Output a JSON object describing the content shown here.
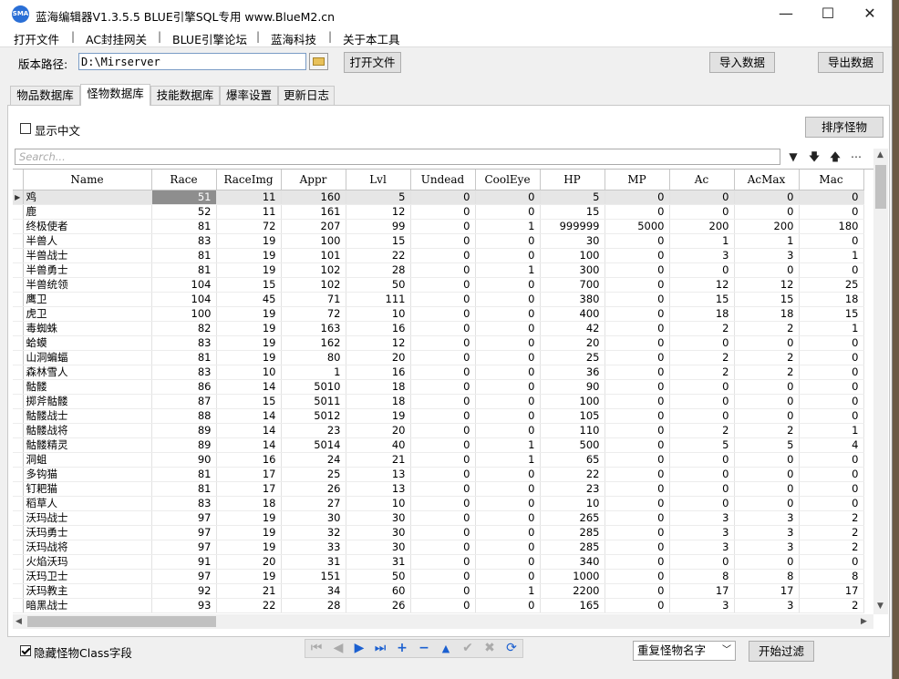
{
  "window": {
    "title": "蓝海编辑器V1.3.5.5  BLUE引擎SQL专用   www.BlueM2.cn",
    "logo_text": "SMA",
    "controls": {
      "minimize": "—",
      "maximize": "☐",
      "close": "✕"
    }
  },
  "menu": [
    "打开文件",
    "AC封挂网关",
    "BLUE引擎论坛",
    "蓝海科技",
    "关于本工具"
  ],
  "menu_separator": "|",
  "path_row": {
    "label": "版本路径:",
    "value": "D:\\Mirserver",
    "open_label": "打开文件",
    "import_label": "导入数据",
    "export_label": "导出数据"
  },
  "tabs": [
    "物品数据库",
    "怪物数据库",
    "技能数据库",
    "爆率设置",
    "更新日志"
  ],
  "active_tab": 1,
  "show_chinese_label": "显示中文",
  "sort_label": "排序怪物",
  "search_placeholder": "Search...",
  "toolbar_icons": {
    "filter": "▼",
    "down": "🡇",
    "up": "🡅",
    "more": "⋯"
  },
  "columns": [
    "Name",
    "Race",
    "RaceImg",
    "Appr",
    "Lvl",
    "Undead",
    "CoolEye",
    "HP",
    "MP",
    "Ac",
    "AcMax",
    "Mac"
  ],
  "rows": [
    [
      "鸡",
      "51",
      "11",
      "160",
      "5",
      "0",
      "0",
      "5",
      "0",
      "0",
      "0",
      "0"
    ],
    [
      "鹿",
      "52",
      "11",
      "161",
      "12",
      "0",
      "0",
      "15",
      "0",
      "0",
      "0",
      "0"
    ],
    [
      "终极使者",
      "81",
      "72",
      "207",
      "99",
      "0",
      "1",
      "999999",
      "5000",
      "200",
      "200",
      "180"
    ],
    [
      "半兽人",
      "83",
      "19",
      "100",
      "15",
      "0",
      "0",
      "30",
      "0",
      "1",
      "1",
      "0"
    ],
    [
      "半兽战士",
      "81",
      "19",
      "101",
      "22",
      "0",
      "0",
      "100",
      "0",
      "3",
      "3",
      "1"
    ],
    [
      "半兽勇士",
      "81",
      "19",
      "102",
      "28",
      "0",
      "1",
      "300",
      "0",
      "0",
      "0",
      "0"
    ],
    [
      "半兽统领",
      "104",
      "15",
      "102",
      "50",
      "0",
      "0",
      "700",
      "0",
      "12",
      "12",
      "25"
    ],
    [
      "鹰卫",
      "104",
      "45",
      "71",
      "111",
      "0",
      "0",
      "380",
      "0",
      "15",
      "15",
      "18"
    ],
    [
      "虎卫",
      "100",
      "19",
      "72",
      "10",
      "0",
      "0",
      "400",
      "0",
      "18",
      "18",
      "15"
    ],
    [
      "毒蜘蛛",
      "82",
      "19",
      "163",
      "16",
      "0",
      "0",
      "42",
      "0",
      "2",
      "2",
      "1"
    ],
    [
      "蛤蟆",
      "83",
      "19",
      "162",
      "12",
      "0",
      "0",
      "20",
      "0",
      "0",
      "0",
      "0"
    ],
    [
      "山洞蝙蝠",
      "81",
      "19",
      "80",
      "20",
      "0",
      "0",
      "25",
      "0",
      "2",
      "2",
      "0"
    ],
    [
      "森林雪人",
      "83",
      "10",
      "1",
      "16",
      "0",
      "0",
      "36",
      "0",
      "2",
      "2",
      "0"
    ],
    [
      "骷髅",
      "86",
      "14",
      "5010",
      "18",
      "0",
      "0",
      "90",
      "0",
      "0",
      "0",
      "0"
    ],
    [
      "掷斧骷髅",
      "87",
      "15",
      "5011",
      "18",
      "0",
      "0",
      "100",
      "0",
      "0",
      "0",
      "0"
    ],
    [
      "骷髅战士",
      "88",
      "14",
      "5012",
      "19",
      "0",
      "0",
      "105",
      "0",
      "0",
      "0",
      "0"
    ],
    [
      "骷髅战将",
      "89",
      "14",
      "23",
      "20",
      "0",
      "0",
      "110",
      "0",
      "2",
      "2",
      "1"
    ],
    [
      "骷髅精灵",
      "89",
      "14",
      "5014",
      "40",
      "0",
      "1",
      "500",
      "0",
      "5",
      "5",
      "4"
    ],
    [
      "洞蛆",
      "90",
      "16",
      "24",
      "21",
      "0",
      "1",
      "65",
      "0",
      "0",
      "0",
      "0"
    ],
    [
      "多钩猫",
      "81",
      "17",
      "25",
      "13",
      "0",
      "0",
      "22",
      "0",
      "0",
      "0",
      "0"
    ],
    [
      "钉耙猫",
      "81",
      "17",
      "26",
      "13",
      "0",
      "0",
      "23",
      "0",
      "0",
      "0",
      "0"
    ],
    [
      "稻草人",
      "83",
      "18",
      "27",
      "10",
      "0",
      "0",
      "10",
      "0",
      "0",
      "0",
      "0"
    ],
    [
      "沃玛战士",
      "97",
      "19",
      "30",
      "30",
      "0",
      "0",
      "265",
      "0",
      "3",
      "3",
      "2"
    ],
    [
      "沃玛勇士",
      "97",
      "19",
      "32",
      "30",
      "0",
      "0",
      "285",
      "0",
      "3",
      "3",
      "2"
    ],
    [
      "沃玛战将",
      "97",
      "19",
      "33",
      "30",
      "0",
      "0",
      "285",
      "0",
      "3",
      "3",
      "2"
    ],
    [
      "火焰沃玛",
      "91",
      "20",
      "31",
      "31",
      "0",
      "0",
      "340",
      "0",
      "0",
      "0",
      "0"
    ],
    [
      "沃玛卫士",
      "97",
      "19",
      "151",
      "50",
      "0",
      "0",
      "1000",
      "0",
      "8",
      "8",
      "8"
    ],
    [
      "沃玛教主",
      "92",
      "21",
      "34",
      "60",
      "0",
      "1",
      "2200",
      "0",
      "17",
      "17",
      "17"
    ],
    [
      "暗黑战士",
      "93",
      "22",
      "28",
      "26",
      "0",
      "0",
      "165",
      "0",
      "3",
      "3",
      "2"
    ]
  ],
  "selected_row": 0,
  "current_row_indicator": "▶",
  "hide_class_label": "隐藏怪物Class字段",
  "hide_class_checked": true,
  "navigator": [
    "⏮",
    "◀",
    "▶",
    "⏭",
    "+",
    "−",
    "▲",
    "✔",
    "✖",
    "⟳"
  ],
  "duplicate_select": "重复怪物名字",
  "filter_label": "开始过滤"
}
